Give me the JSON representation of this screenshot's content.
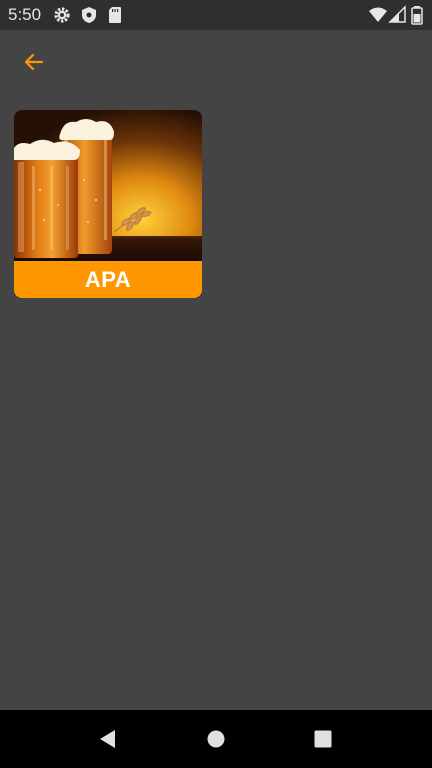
{
  "status_bar": {
    "time": "5:50",
    "icons": [
      "settings-gear-icon",
      "shield-icon",
      "sd-card-icon",
      "wifi-icon",
      "signal-icon",
      "battery-icon"
    ]
  },
  "toolbar": {
    "back_icon": "arrow-back-icon",
    "accent_color": "#ff9800"
  },
  "grid": {
    "items": [
      {
        "label": "APA",
        "image": "beer-mugs-photo"
      }
    ]
  },
  "nav_bar": {
    "buttons": [
      "back-triangle-icon",
      "home-circle-icon",
      "recents-square-icon"
    ]
  },
  "colors": {
    "background": "#444444",
    "status_bar": "#2f2f2f",
    "accent": "#ff9800",
    "nav_bar": "#000000"
  }
}
